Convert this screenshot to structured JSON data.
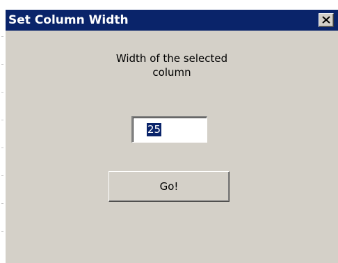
{
  "window": {
    "title": "Set Column Width",
    "close_icon": "close-icon"
  },
  "prompt": {
    "line1": "Width of the selected",
    "line2": "column"
  },
  "width_field": {
    "value": "25",
    "selected": true
  },
  "actions": {
    "go_label": "Go!"
  },
  "colors": {
    "titlebar": "#0a246a",
    "dialog_face": "#d4d0c8",
    "selection": "#0a246a"
  }
}
